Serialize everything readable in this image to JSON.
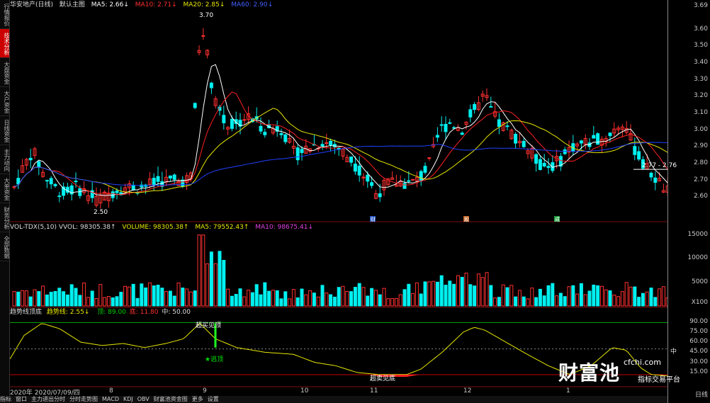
{
  "sidebar": {
    "items": [
      "行情报价",
      "技术分析",
      "大盘资金",
      "大户资金",
      "日线资金",
      "主力动向",
      "大单资金",
      "财务分析",
      "全部数据"
    ],
    "active_index": 1
  },
  "price_panel": {
    "title": "华安地产(日线)",
    "indicator": "默认主图",
    "ma5": "MA5: 2.66↓",
    "ma10": "MA10: 2.71↓",
    "ma20": "MA20: 2.85↓",
    "ma60": "MA60: 2.90↓",
    "high_label": "3.70",
    "low_label": "2.50",
    "range_label": "2.77 - 2.76",
    "yticks": [
      "3.69",
      "3.60",
      "3.50",
      "3.40",
      "3.30",
      "3.20",
      "3.10",
      "3.00",
      "2.90",
      "2.80",
      "2.70",
      "2.60"
    ],
    "markers": [
      "财",
      "股",
      "成"
    ],
    "colors": {
      "ma5": "#ffffff",
      "ma10": "#ff2020",
      "ma20": "#e6e600",
      "ma60": "#2040ff",
      "up": "#ff3030",
      "down": "#00f0f0"
    }
  },
  "volume_panel": {
    "title": "VOL-TDX(5,10) VVOL: 98305.38↑",
    "volume": "VOLUME: 98305.38↑",
    "ma5": "MA5: 79552.43↑",
    "ma10": "MA10: 98675.41↓",
    "yticks": [
      "15000",
      "10000",
      "5000",
      "X100"
    ]
  },
  "trend_panel": {
    "title": "趋势线顶底",
    "trend": "趋势线: 2.55↓",
    "top": "顶: 89.00",
    "bottom": "底: 11.80",
    "mid": "中: 50.00",
    "top_signal": "超买见顶",
    "sell": "★逃顶",
    "bottom_signal": "超卖见底",
    "yticks": [
      "90.00",
      "75.00",
      "60.00",
      "45.00",
      "30.00",
      "15.00"
    ],
    "mid_label": "中"
  },
  "dates": {
    "first": "2020年 2020/07/09/四",
    "months": [
      "8",
      "9",
      "10",
      "11",
      "12",
      "1"
    ]
  },
  "bottombar": [
    "指标",
    "窗口",
    "主力进出分时",
    "分时走势图",
    "MACD",
    "KDJ",
    "OBV",
    "财富池资金图",
    "更多",
    "设置"
  ],
  "watermark": {
    "brand": "财富池",
    "url": "cfchi.com",
    "sub": "指标交易平台"
  },
  "axis_unit": "日线"
}
